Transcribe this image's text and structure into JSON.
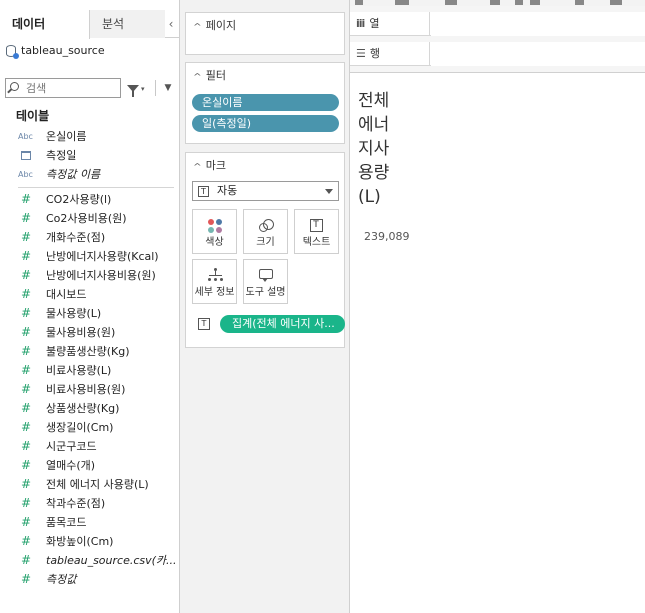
{
  "data_pane": {
    "tabs": {
      "data": "데이터",
      "analysis": "분석"
    },
    "collapse_glyph": "‹",
    "source": "tableau_source",
    "search": {
      "placeholder": "검색",
      "value": ""
    },
    "tables_heading": "테이블",
    "dimensions": [
      {
        "name": "온실이름",
        "type": "Abc",
        "italic": false
      },
      {
        "name": "측정일",
        "type": "date",
        "italic": false
      },
      {
        "name": "측정값 이름",
        "type": "Abc",
        "italic": true
      }
    ],
    "measures": [
      {
        "name": "CO2사용량(l)",
        "italic": false
      },
      {
        "name": "Co2사용비용(원)",
        "italic": false
      },
      {
        "name": "개화수준(점)",
        "italic": false
      },
      {
        "name": "난방에너지사용량(Kcal)",
        "italic": false
      },
      {
        "name": "난방에너지사용비용(원)",
        "italic": false
      },
      {
        "name": "대시보드",
        "italic": false
      },
      {
        "name": "물사용량(L)",
        "italic": false
      },
      {
        "name": "물사용비용(원)",
        "italic": false
      },
      {
        "name": "불량품생산량(Kg)",
        "italic": false
      },
      {
        "name": "비료사용량(L)",
        "italic": false
      },
      {
        "name": "비료사용비용(원)",
        "italic": false
      },
      {
        "name": "상품생산량(Kg)",
        "italic": false
      },
      {
        "name": "생장길이(Cm)",
        "italic": false
      },
      {
        "name": "시군구코드",
        "italic": false
      },
      {
        "name": "열매수(개)",
        "italic": false
      },
      {
        "name": "전체 에너지 사용량(L)",
        "italic": false
      },
      {
        "name": "착과수준(점)",
        "italic": false
      },
      {
        "name": "품목코드",
        "italic": false
      },
      {
        "name": "화방높이(Cm)",
        "italic": false
      },
      {
        "name": "tableau_source.csv(카...",
        "italic": true
      },
      {
        "name": "측정값",
        "italic": true
      }
    ]
  },
  "cards": {
    "pages": {
      "title": "페이지"
    },
    "filters": {
      "title": "필터",
      "pills": [
        "온실이름",
        "일(측정일)"
      ]
    },
    "marks": {
      "title": "마크",
      "type_value": "자동",
      "buttons": {
        "color": "색상",
        "size": "크기",
        "text": "텍스트",
        "detail": "세부 정보",
        "tooltip": "도구 설명"
      },
      "field_pill": "집계(전체 에너지 사..."
    }
  },
  "shelves": {
    "columns": "열",
    "rows": "행"
  },
  "view": {
    "title_lines": [
      "전체",
      "에너",
      "지사",
      "용량",
      "(L)"
    ],
    "value": "239,089"
  },
  "colors": {
    "filter_pill": "#4a95ad",
    "measure_pill": "#1ab58a",
    "measure_icon": "#22a06b"
  }
}
